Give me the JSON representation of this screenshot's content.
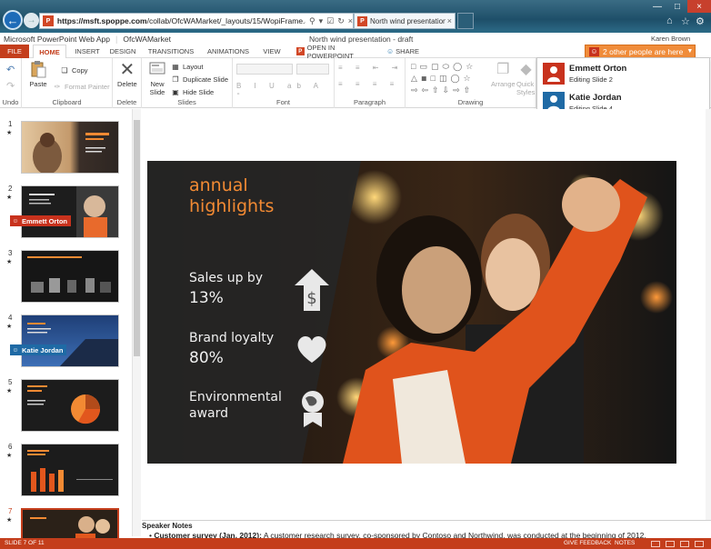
{
  "browser": {
    "url_domain": "https://msft.spoppe.com",
    "url_path": "/collab/OfcWAMarket/_layouts/15/WopiFrame.aspx?sourcec",
    "tab_title": "North wind presentation - ...",
    "site_icon_letter": "P"
  },
  "app": {
    "name": "Microsoft PowerPoint Web App",
    "site": "OfcWAMarket",
    "doc_title": "North wind presentation - draft",
    "user": "Karen Brown"
  },
  "ribbon_tabs": {
    "file": "FILE",
    "home": "HOME",
    "insert": "INSERT",
    "design": "DESIGN",
    "transitions": "TRANSITIONS",
    "animations": "ANIMATIONS",
    "view": "VIEW",
    "open_in_powerpoint": "OPEN IN POWERPOINT",
    "share": "SHARE"
  },
  "people_indicator": "2 other people are here",
  "ribbon": {
    "undo_group": "Undo",
    "paste": "Paste",
    "copy": "Copy",
    "format_painter": "Format Painter",
    "clipboard_group": "Clipboard",
    "delete": "Delete",
    "delete_group": "Delete",
    "new_slide": "New Slide",
    "layout": "Layout",
    "duplicate_slide": "Duplicate Slide",
    "hide_slide": "Hide Slide",
    "slides_group": "Slides",
    "font_group": "Font",
    "paragraph_group": "Paragraph",
    "arrange": "Arrange",
    "quick_styles": "Quick Styles",
    "drawing_group": "Drawing"
  },
  "collaborators": [
    {
      "name": "Emmett Orton",
      "status": "Editing Slide 2",
      "color": "#c8321d"
    },
    {
      "name": "Katie Jordan",
      "status": "Editing Slide 4",
      "color": "#1f6aa5"
    }
  ],
  "thumbnails": [
    {
      "num": "1"
    },
    {
      "num": "2",
      "editor": "Emmett Orton"
    },
    {
      "num": "3"
    },
    {
      "num": "4",
      "editor": "Katie Jordan"
    },
    {
      "num": "5"
    },
    {
      "num": "6"
    },
    {
      "num": "7"
    }
  ],
  "thumb_text": {
    "t1": "Northwind Lodge",
    "t3": "Looking forward to...",
    "t4": "Good News",
    "t5": "Katie Jordan",
    "t6": "Annual sales"
  },
  "slide": {
    "title_line1": "annual",
    "title_line2": "highlights",
    "stat1_label": "Sales up by",
    "stat1_value": "13%",
    "stat2_label": "Brand loyalty",
    "stat2_value": "80%",
    "stat3_label_line1": "Environmental",
    "stat3_label_line2": "award"
  },
  "notes": {
    "heading": "Speaker Notes",
    "bullet_bold": "Customer survey (Jan. 2012):",
    "bullet_text": " A customer research survey, co-sponsored by Contoso and Northwind, was conducted at the beginning of 2012."
  },
  "status": {
    "slide_count": "SLIDE 7 OF 11",
    "feedback": "GIVE FEEDBACK",
    "notes": "NOTES"
  },
  "colors": {
    "accent": "#c43e1c",
    "slide_orange": "#f28a33",
    "people_orange": "#f08c3a"
  }
}
